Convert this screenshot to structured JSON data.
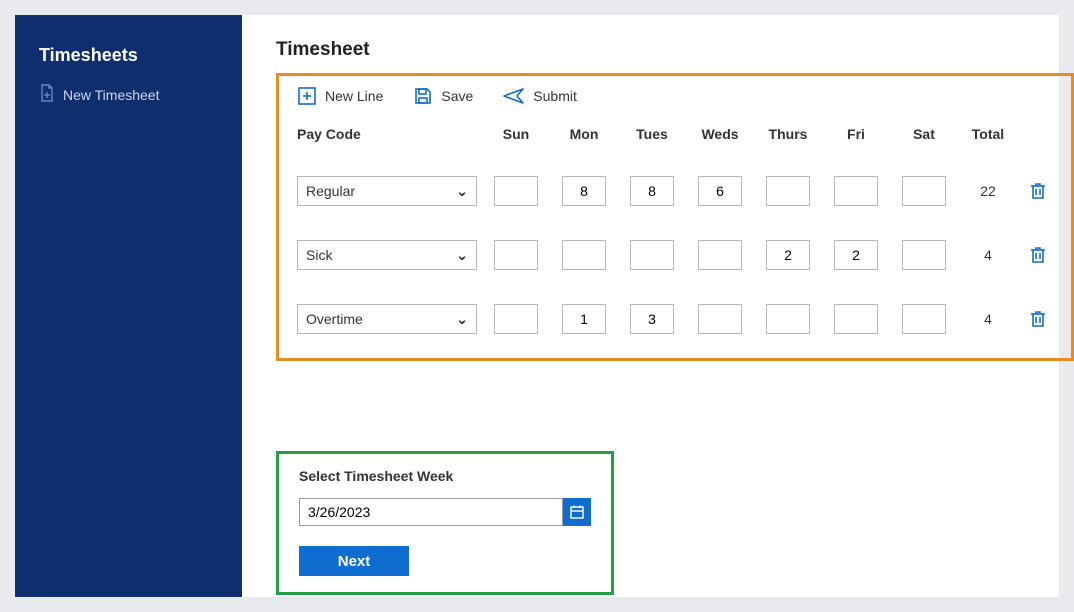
{
  "sidebar": {
    "title": "Timesheets",
    "new_timesheet_label": "New Timesheet"
  },
  "page": {
    "title": "Timesheet"
  },
  "toolbar": {
    "new_line": "New Line",
    "save": "Save",
    "submit": "Submit"
  },
  "columns": {
    "pay_code": "Pay Code",
    "sun": "Sun",
    "mon": "Mon",
    "tues": "Tues",
    "weds": "Weds",
    "thurs": "Thurs",
    "fri": "Fri",
    "sat": "Sat",
    "total": "Total"
  },
  "rows": [
    {
      "pay_code": "Regular",
      "sun": "",
      "mon": "8",
      "tues": "8",
      "weds": "6",
      "thurs": "",
      "fri": "",
      "sat": "",
      "total": "22"
    },
    {
      "pay_code": "Sick",
      "sun": "",
      "mon": "",
      "tues": "",
      "weds": "",
      "thurs": "2",
      "fri": "2",
      "sat": "",
      "total": "4"
    },
    {
      "pay_code": "Overtime",
      "sun": "",
      "mon": "1",
      "tues": "3",
      "weds": "",
      "thurs": "",
      "fri": "",
      "sat": "",
      "total": "4"
    }
  ],
  "week_picker": {
    "label": "Select Timesheet Week",
    "value": "3/26/2023",
    "next": "Next"
  },
  "colors": {
    "sidebar_bg": "#0f2e6e",
    "accent_blue": "#0e6dcf",
    "highlight_orange": "#e88c26",
    "highlight_green": "#23a043"
  }
}
